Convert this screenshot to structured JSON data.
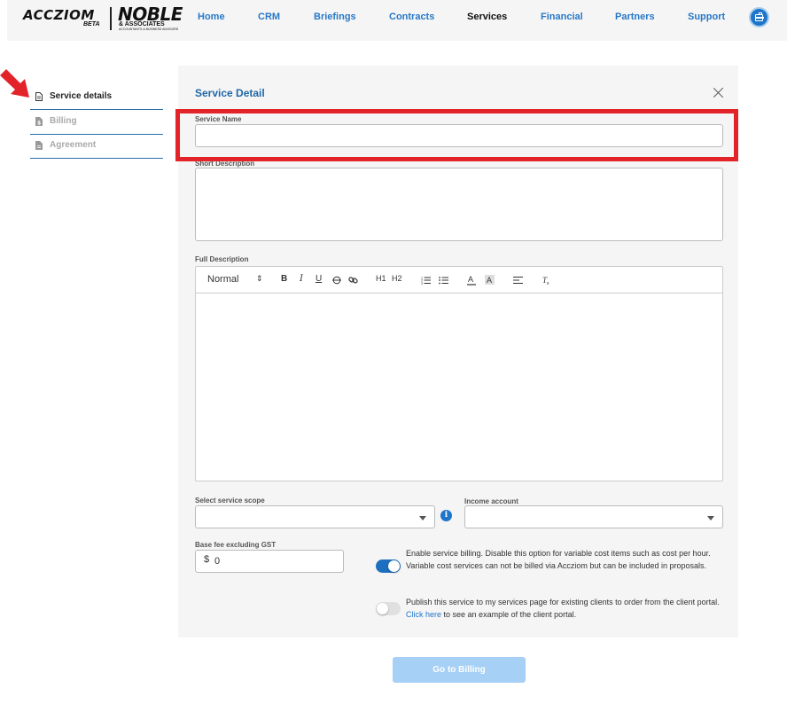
{
  "brand": {
    "logo_primary": "ACCZIOM",
    "logo_primary_tag": "BETA",
    "logo_secondary": "NOBLE",
    "logo_secondary_sub": "& ASSOCIATES",
    "logo_secondary_tagline": "ACCOUNTANTS & BUSINESS ADVISORS"
  },
  "nav": {
    "items": [
      {
        "label": "Home"
      },
      {
        "label": "CRM"
      },
      {
        "label": "Briefings"
      },
      {
        "label": "Contracts"
      },
      {
        "label": "Services",
        "active": true
      },
      {
        "label": "Financial"
      },
      {
        "label": "Partners"
      },
      {
        "label": "Support"
      }
    ],
    "profile_icon": "briefcase-icon"
  },
  "sidebar": {
    "items": [
      {
        "label": "Service details",
        "icon": "document-icon",
        "state": "active"
      },
      {
        "label": "Billing",
        "icon": "dollar-file-icon",
        "state": "disabled"
      },
      {
        "label": "Agreement",
        "icon": "file-icon",
        "state": "disabled"
      }
    ]
  },
  "panel": {
    "title": "Service Detail",
    "service_name": {
      "label": "Service Name",
      "value": ""
    },
    "short_description": {
      "label": "Short Description",
      "value": ""
    },
    "full_description": {
      "label": "Full Description",
      "toolbar": {
        "format": "Normal",
        "bold": "B",
        "italic": "I",
        "underline": "U",
        "h1": "H1",
        "h2": "H2"
      }
    },
    "scope": {
      "label": "Select service scope",
      "value": ""
    },
    "income_account": {
      "label": "Income account",
      "value": ""
    },
    "base_fee": {
      "label": "Base fee excluding GST",
      "prefix": "$",
      "value": "0"
    },
    "billing_toggle": {
      "on": true,
      "text": "Enable service billing. Disable this option for variable cost items such as cost per hour. Variable cost services can not be billed via Accziom but can be included in proposals."
    },
    "publish_toggle": {
      "on": false,
      "text_before": "Publish this service to my services page for existing clients to order from the client portal.",
      "link": "Click here",
      "text_after": "to see an example of the client portal."
    }
  },
  "footer": {
    "go_button": "Go to Billing"
  },
  "colors": {
    "accent": "#1f76c9",
    "highlight": "#e3232a",
    "toggle_on": "#1e6fc0",
    "button_disabled": "#a6d0f5"
  }
}
